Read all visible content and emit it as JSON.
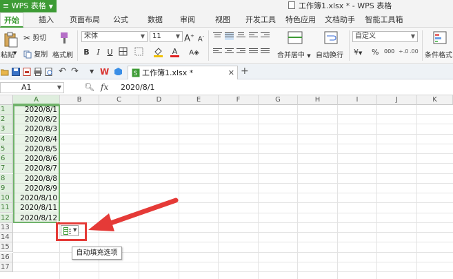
{
  "titlebar": {
    "app_name": "WPS 表格",
    "doc_title": "工作簿1.xlsx * - WPS 表格"
  },
  "tabs": [
    "开始",
    "插入",
    "页面布局",
    "公式",
    "数据",
    "审阅",
    "视图",
    "开发工具",
    "特色应用",
    "文档助手",
    "智能工具箱"
  ],
  "ribbon": {
    "paste": "粘贴",
    "cut": "剪切",
    "copy": "复制",
    "format_painter": "格式刷",
    "font_name": "宋体",
    "font_size": "11",
    "bold": "B",
    "italic": "I",
    "underline": "U",
    "grow_font": "A",
    "shrink_font": "A",
    "merge_center": "合并居中",
    "wrap_text": "自动换行",
    "number_format": "自定义",
    "currency": "¥",
    "percent": "%",
    "comma": "000",
    "conditional_format": "条件格式"
  },
  "doc_tab": {
    "name": "工作簿1.xlsx *"
  },
  "formula_bar": {
    "cell_ref": "A1",
    "fx": "fx",
    "value": "2020/8/1"
  },
  "columns": [
    "A",
    "B",
    "C",
    "D",
    "E",
    "F",
    "G",
    "H",
    "I",
    "J",
    "K"
  ],
  "rows": [
    "1",
    "2",
    "3",
    "4",
    "5",
    "6",
    "7",
    "8",
    "9",
    "10",
    "11",
    "12",
    "13",
    "14",
    "15",
    "16",
    "17"
  ],
  "cells_A": [
    "2020/8/1",
    "2020/8/2",
    "2020/8/3",
    "2020/8/4",
    "2020/8/5",
    "2020/8/6",
    "2020/8/7",
    "2020/8/8",
    "2020/8/9",
    "2020/8/10",
    "2020/8/11",
    "2020/8/12"
  ],
  "tooltip": "自动填充选项",
  "colors": {
    "accent": "#3d9b35",
    "highlight": "#e53a37",
    "selection": "#6fb26a"
  }
}
